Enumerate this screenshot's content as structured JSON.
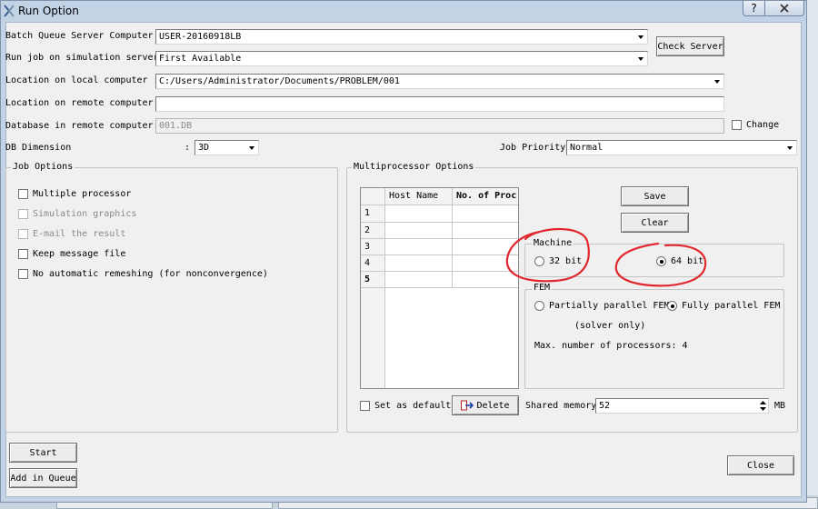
{
  "window": {
    "title": "Run Option",
    "help_label": "?",
    "close_icon": "close-icon"
  },
  "fields": {
    "batch_label": "Batch Queue Server Computer :",
    "batch_value": "USER-20160918LB",
    "run_label": "Run job on simulation server:",
    "run_value": "First Available",
    "local_label": "Location on local computer :",
    "local_value": "C:/Users/Administrator/Documents/PROBLEM/001",
    "remote_label": "Location on remote computer:",
    "remote_value": "",
    "db_label": "Database in remote computer:",
    "db_value": "001.DB",
    "change_label": "Change",
    "dim_label": "DB Dimension",
    "dim_colon": ":",
    "dim_value": "3D",
    "priority_label": "Job Priority",
    "priority_value": "Normal"
  },
  "buttons": {
    "check_server": "Check Server",
    "save": "Save",
    "clear": "Clear",
    "delete": "Delete",
    "start": "Start",
    "add_queue": "Add in Queue",
    "close": "Close"
  },
  "job_options": {
    "title": "Job Options",
    "items": [
      {
        "label": "Multiple processor",
        "enabled": true
      },
      {
        "label": "Simulation graphics",
        "enabled": false
      },
      {
        "label": "E-mail the result",
        "enabled": false
      },
      {
        "label": "Keep message file",
        "enabled": true
      },
      {
        "label": "No automatic remeshing (for nonconvergence)",
        "enabled": true
      }
    ]
  },
  "multiprocessor": {
    "title": "Multiprocessor Options",
    "grid": {
      "col_host": "Host Name",
      "col_procs": "No. of Proc",
      "rows": [
        "1",
        "2",
        "3",
        "4",
        "5"
      ]
    },
    "set_default": "Set as default",
    "shared_memory_label": "Shared memory",
    "shared_memory_value": "52",
    "shared_memory_unit": "MB",
    "machine": {
      "title": "Machine",
      "opt32": "32 bit",
      "opt64": "64 bit",
      "selected": "64 bit"
    },
    "fem": {
      "title": "FEM",
      "partial": "Partially parallel FEM",
      "full": "Fully parallel FEM",
      "solver_only": "(solver only)",
      "max_procs": "Max. number of processors: 4",
      "selected": "Fully parallel FEM"
    }
  },
  "colors": {
    "annotation_red": "#e0282e",
    "window_frame": "#c3d3e6"
  }
}
